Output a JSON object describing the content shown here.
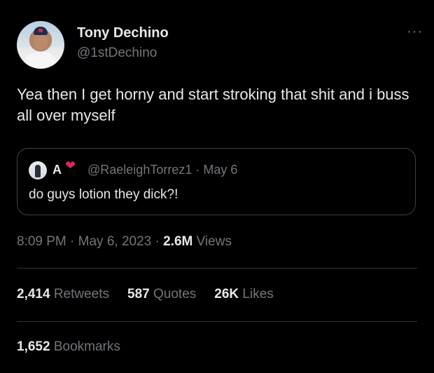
{
  "author": {
    "display_name": "Tony Dechino",
    "handle": "@1stDechino",
    "more_icon": "···"
  },
  "tweet": {
    "text": "Yea then I get horny and start stroking that shit and i buss all over myself"
  },
  "quoted_tweet": {
    "name": "A",
    "heart_icon": "❤",
    "handle_date": "@RaeleighTorrez1 · May 6",
    "text": "do guys lotion they dick?!"
  },
  "meta": {
    "time_date": "8:09 PM · May 6, 2023 · ",
    "views_count": "2.6M",
    "views_label": " Views"
  },
  "stats": {
    "retweets_count": "2,414",
    "retweets_label": " Retweets",
    "quotes_count": "587",
    "quotes_label": " Quotes",
    "likes_count": "26K",
    "likes_label": " Likes"
  },
  "bookmarks": {
    "count": "1,652",
    "label": " Bookmarks"
  }
}
